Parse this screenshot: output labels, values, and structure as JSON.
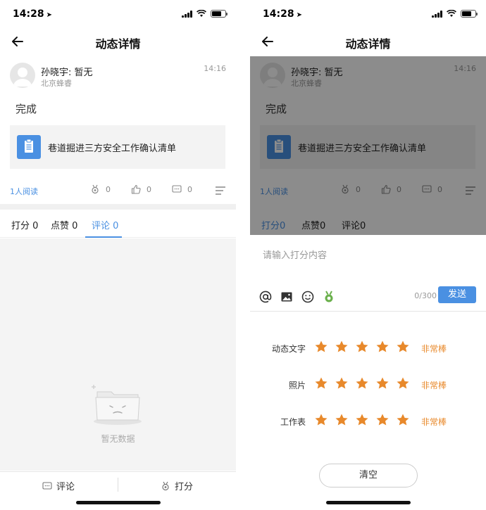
{
  "status": {
    "time": "14:28"
  },
  "nav": {
    "title": "动态详情"
  },
  "post": {
    "author": "孙晓宇: 暂无",
    "location": "北京蜂睿",
    "time": "14:16",
    "content": "完成",
    "attachment_title": "巷道掘进三方安全工作确认清单"
  },
  "stats": {
    "read_count": "1人阅读",
    "score": "0",
    "likes": "0",
    "comments": "0"
  },
  "tabs": [
    {
      "label": "打分",
      "count": "0"
    },
    {
      "label": "点赞",
      "count": "0"
    },
    {
      "label": "评论",
      "count": "0"
    }
  ],
  "empty": {
    "text": "暂无数据"
  },
  "bottom_bar": {
    "comment_label": "评论",
    "score_label": "打分"
  },
  "sheet": {
    "input_placeholder": "请输入打分内容",
    "char_count": "0/300",
    "send_label": "发送",
    "clear_label": "清空"
  },
  "ratings": [
    {
      "label": "动态文字",
      "stars": 5,
      "text": "非常棒"
    },
    {
      "label": "照片",
      "stars": 5,
      "text": "非常棒"
    },
    {
      "label": "工作表",
      "stars": 5,
      "text": "非常棒"
    }
  ],
  "colors": {
    "accent": "#4a90e2",
    "star": "#e8892b",
    "overlay": "rgba(0,0,0,0.45)"
  },
  "icons": [
    "back-arrow-icon",
    "location-arrow-icon",
    "signal-icon",
    "wifi-icon",
    "battery-icon",
    "document-icon",
    "medal-icon",
    "thumbs-up-icon",
    "comment-icon",
    "menu-icon",
    "at-icon",
    "image-icon",
    "emoji-icon",
    "green-medal-icon",
    "star-icon",
    "empty-folder-icon"
  ]
}
